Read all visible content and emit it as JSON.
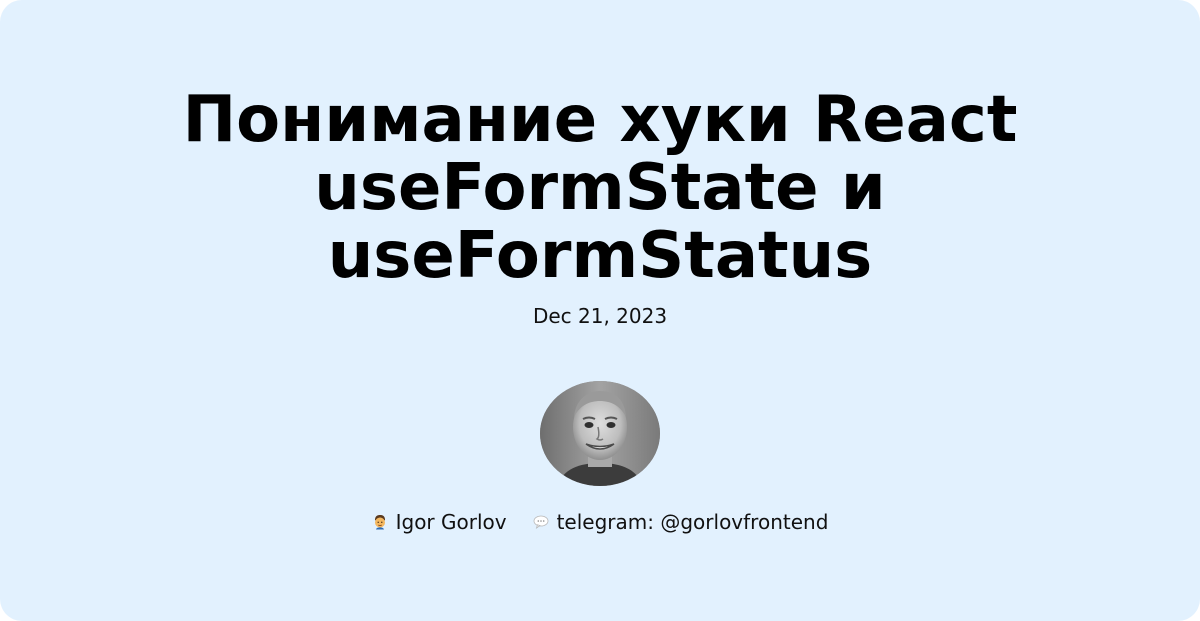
{
  "article": {
    "title": "Понимание хуки React useFormState и useFormStatus",
    "date": "Dec 21, 2023"
  },
  "author": {
    "name": "Igor Gorlov",
    "name_icon": "man-emoji-icon",
    "contact": "telegram: @gorlovfrontend",
    "contact_icon": "speech-bubble-icon"
  },
  "colors": {
    "background": "#e2f1fe",
    "text": "#000000"
  }
}
